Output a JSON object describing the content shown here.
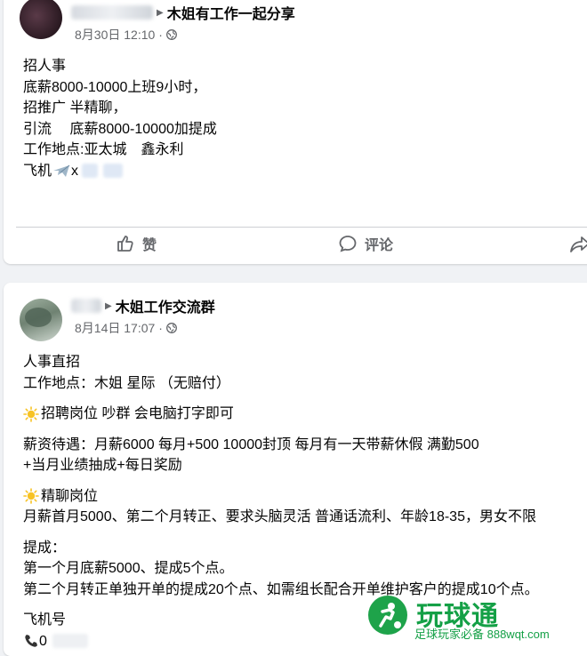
{
  "post1": {
    "group": "木姐有工作一起分享",
    "date": "8月30日 12:10",
    "lines": [
      "招人事",
      "底薪8000-10000上班9小时，",
      "招推广 半精聊，",
      "引流　  底薪8000-10000加提成",
      "工作地点:亚太城　鑫永利",
      "飞机"
    ],
    "contact_partial": "x",
    "actions": {
      "like": "赞",
      "comment": "评论"
    }
  },
  "post2": {
    "group": "木姐工作交流群",
    "date": "8月14日 17:07",
    "lines": [
      "人事直招",
      "工作地点：木姐 星际 （无赔付）",
      "招聘岗位 吵群 会电脑打字即可",
      "薪资待遇：月薪6000 每月+500  10000封顶 每月有一天带薪休假 满勤500",
      " +当月业绩抽成+每日奖励",
      "精聊岗位",
      "月薪首月5000、第二个月转正、要求头脑灵活 普通话流利、年龄18-35，男女不限",
      "提成：",
      "第一个月底薪5000、提成5个点。",
      "第二个月转正单独开单的提成20个点、如需组长配合开单维护客户的提成10个点。",
      "飞机号"
    ],
    "contact_partial": "0"
  },
  "watermark": {
    "title": "玩球通",
    "subtitle": "足球玩家必备 888wqt.com"
  },
  "colors": {
    "accent_green": "#14a046",
    "meta_gray": "#65676b"
  },
  "icons": [
    "globe-icon",
    "like-icon",
    "comment-icon",
    "share-icon",
    "sun-icon",
    "airplane-icon",
    "phone-icon"
  ]
}
